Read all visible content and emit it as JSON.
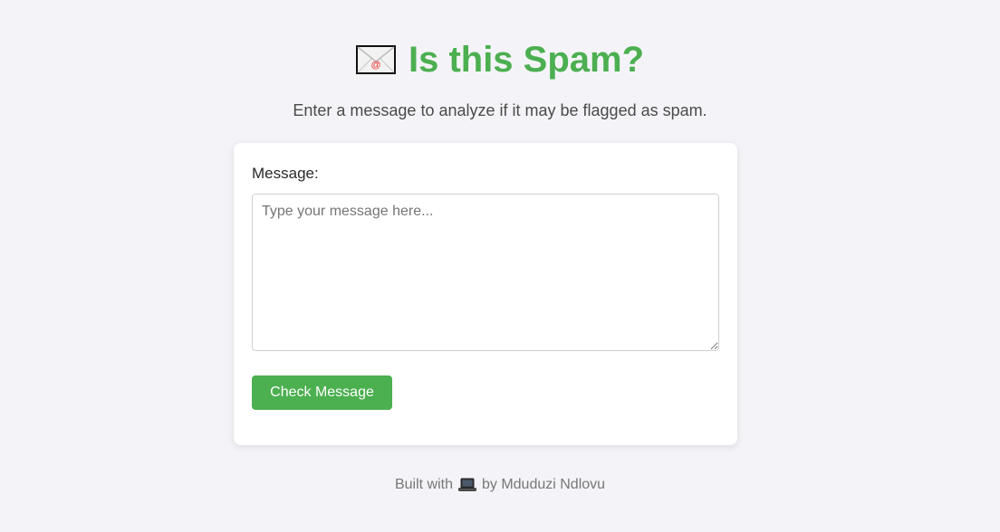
{
  "header": {
    "icon": "envelope-icon",
    "title": "Is this Spam?",
    "subtitle": "Enter a message to analyze if it may be flagged as spam.",
    "accent_color": "#4caf50"
  },
  "form": {
    "message_label": "Message:",
    "message_placeholder": "Type your message here...",
    "message_value": "",
    "submit_label": "Check Message"
  },
  "footer": {
    "prefix": "Built with",
    "icon": "laptop-icon",
    "suffix": "by Mduduzi Ndlovu"
  }
}
